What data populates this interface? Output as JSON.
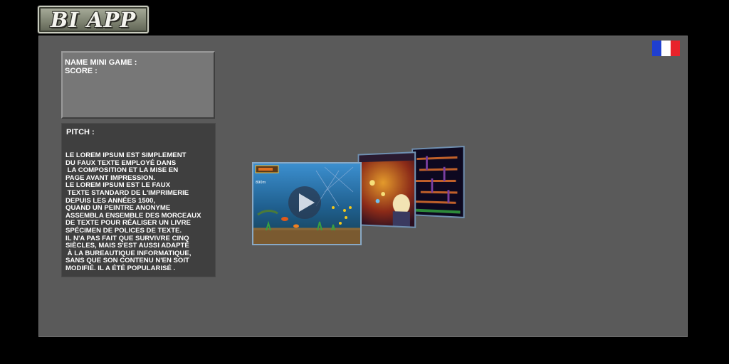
{
  "app": {
    "logo_text": "BI APP"
  },
  "language": {
    "flag_colors": [
      "#1f3fd0",
      "#ffffff",
      "#e8222a"
    ],
    "icon": "french-flag-icon"
  },
  "info_box": {
    "name_label": "NAME MINI GAME :",
    "score_label": "SCORE :"
  },
  "pitch": {
    "title": "PITCH :",
    "text": "LE LOREM IPSUM EST SIMPLEMENT\nDU FAUX TEXTE EMPLOYÉ DANS\n LA COMPOSITION ET LA MISE EN\nPAGE AVANT IMPRESSION.\nLE LOREM IPSUM EST LE FAUX\n TEXTE STANDARD DE L'IMPRIMERIE\nDEPUIS LES ANNÉES 1500,\nQUAND UN PEINTRE ANONYME\nASSEMBLA ENSEMBLE DES MORCEAUX\nDE TEXTE POUR RÉALISER UN LIVRE\nSPÉCIMEN DE POLICES DE TEXTE.\nIL N'A PAS FAIT QUE SURVIVRE CINQ\nSIÈCLES, MAIS S'EST AUSSI ADAPTÉ\n À LA BUREAUTIQUE INFORMATIQUE,\nSANS QUE SON CONTENU N'EN SOIT\nMODIFIÉ. IL A ÉTÉ POPULARISÉ ."
  },
  "carousel": {
    "featured": {
      "hud_value": "890m",
      "play_icon": "play-icon"
    },
    "cards": [
      "underwater-game-screenshot",
      "anime-game-screenshot",
      "platformer-game-screenshot"
    ]
  }
}
